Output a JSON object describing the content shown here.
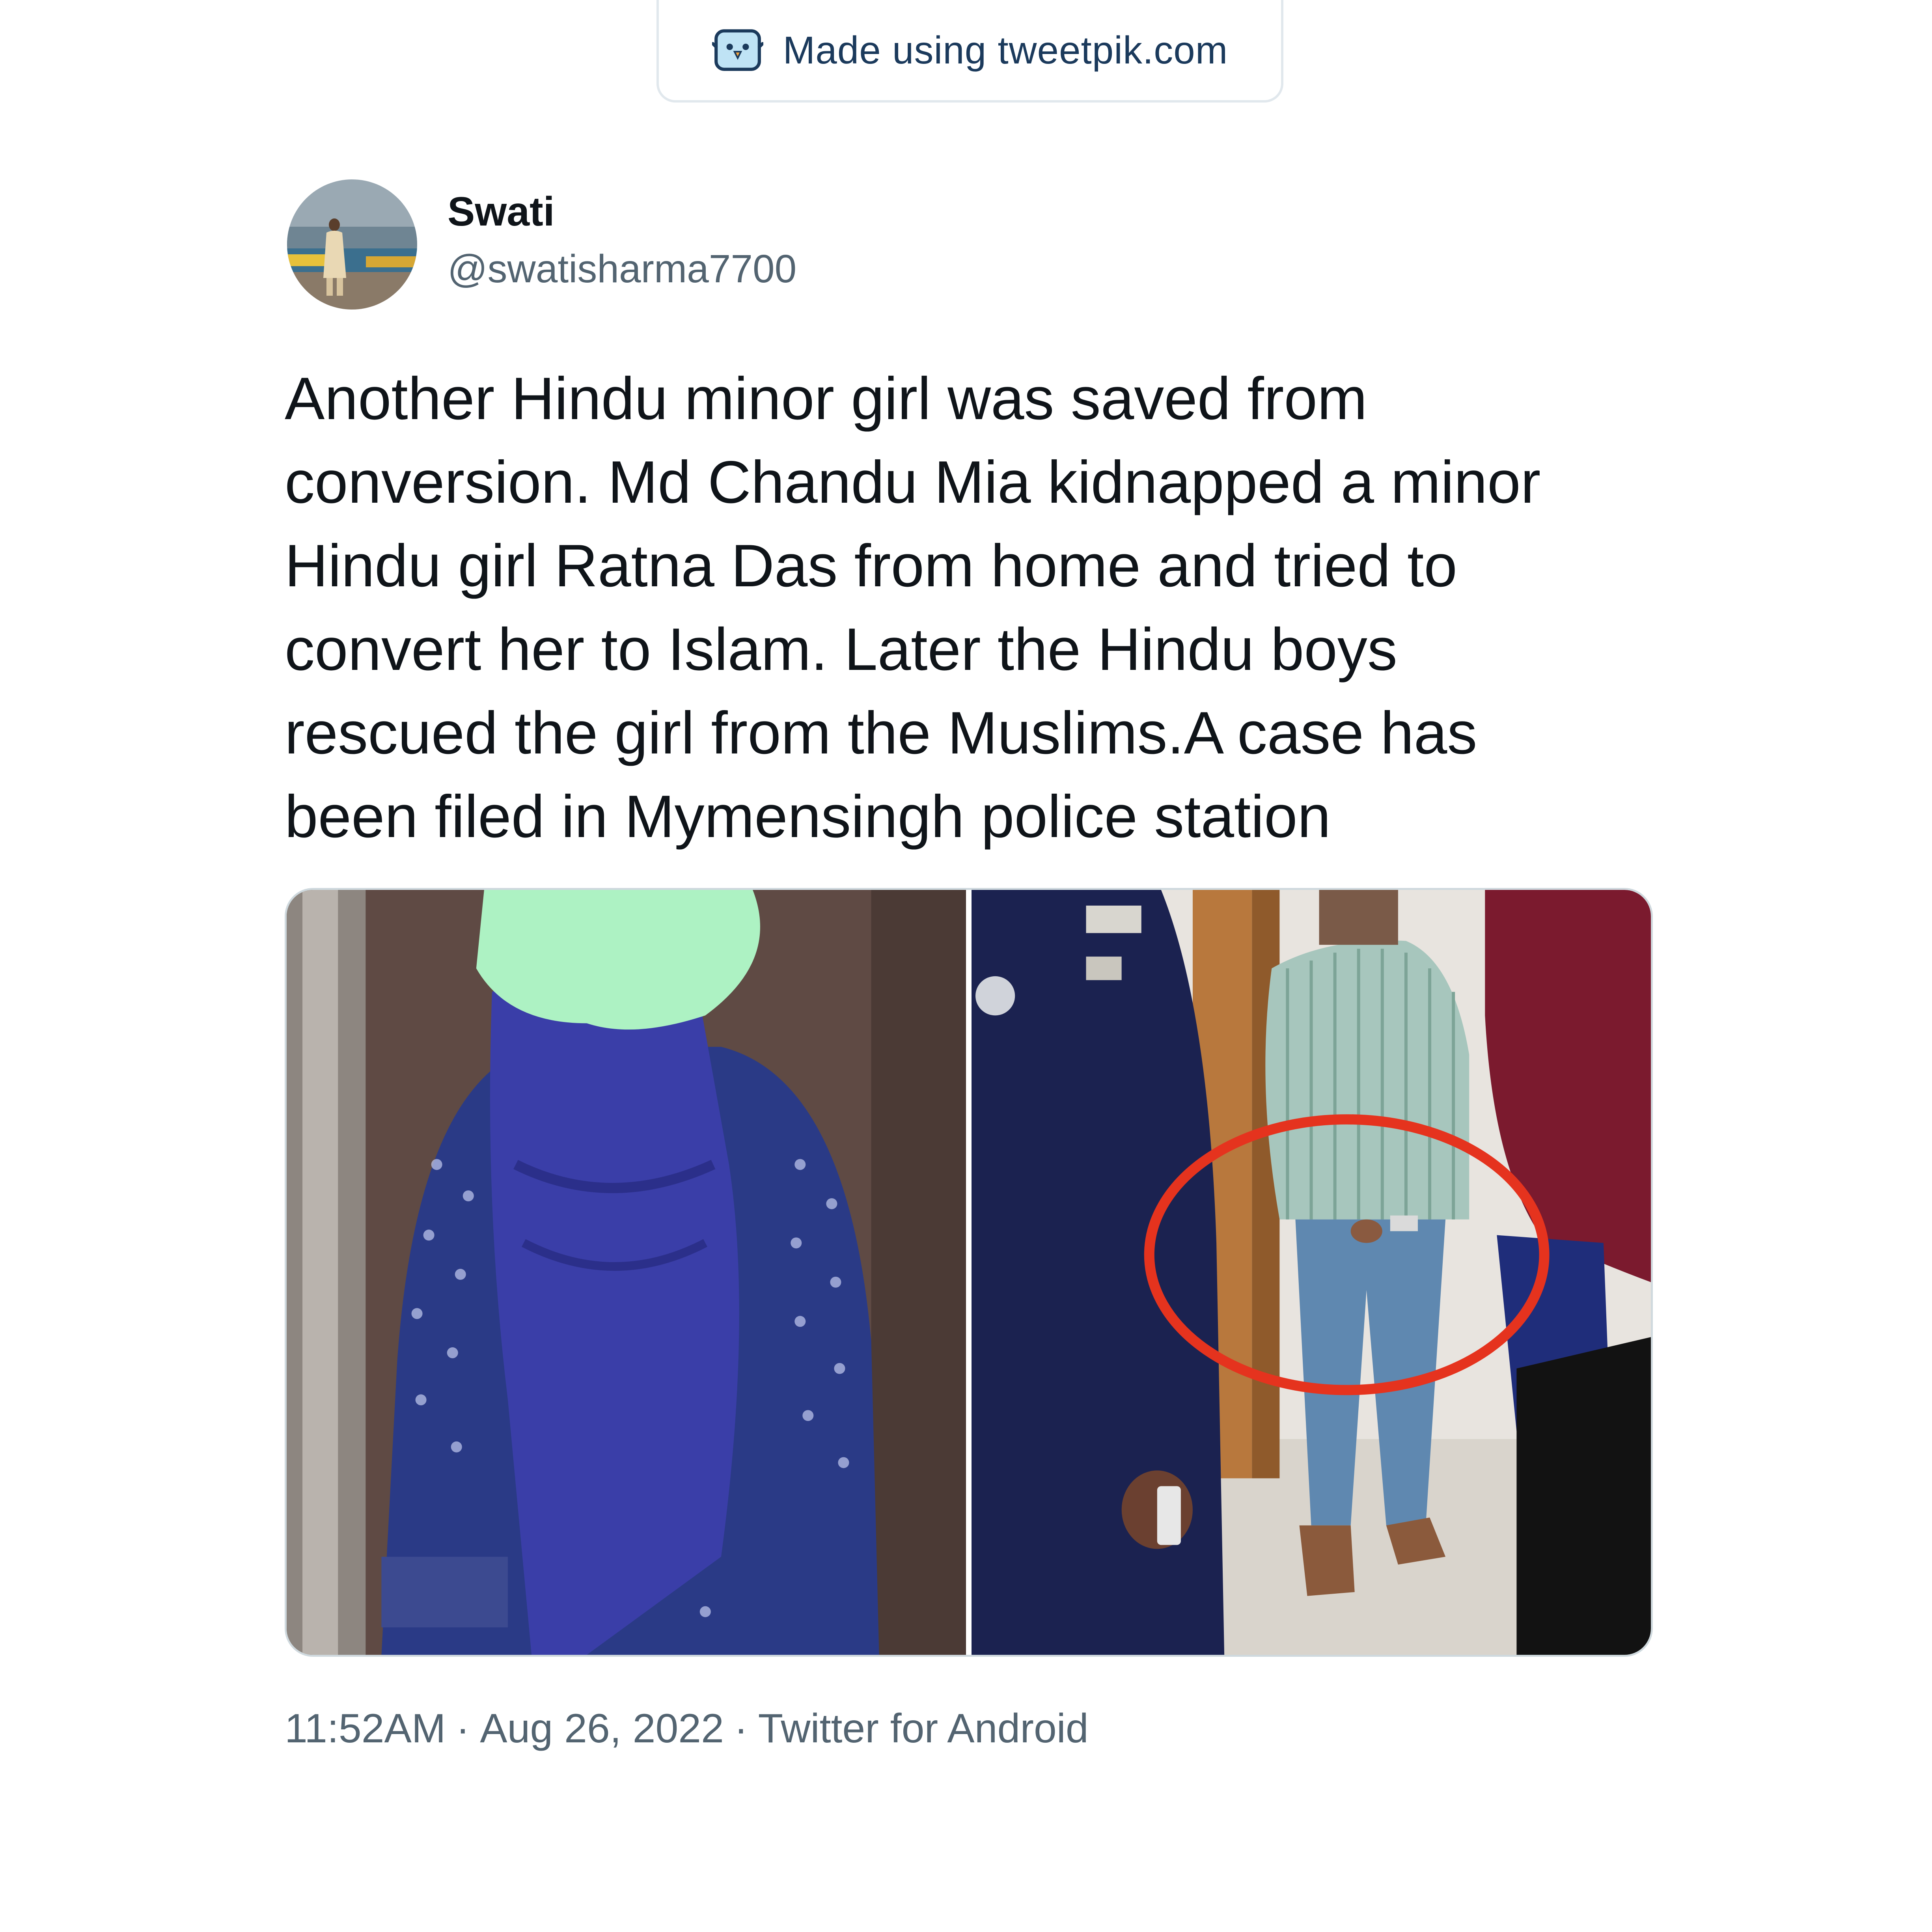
{
  "watermark": {
    "text": "Made using tweetpik.com",
    "icon": "tweetpik-bird-icon"
  },
  "author": {
    "display_name": "Swati",
    "handle": "@swatisharma7700",
    "avatar": "profile-photo"
  },
  "tweet": {
    "lines": [
      "Another Hindu minor girl was saved from",
      "conversion. Md Chandu Mia kidnapped a minor",
      "Hindu girl Ratna Das from home and tried to",
      "convert her to Islam. Later the Hindu boys",
      "rescued the girl from the Muslims.A case has",
      "been filed in Mymensingh police station"
    ]
  },
  "media": {
    "count": 2,
    "items": [
      "photo-girl-in-blue-scarf",
      "photo-man-with-police-circled"
    ]
  },
  "meta": {
    "time": "11:52AM",
    "date": "Aug 26, 2022",
    "source": "Twitter for Android",
    "separator": "·"
  },
  "colors": {
    "text_primary": "#0f1419",
    "text_secondary": "#536471",
    "border": "#cfd9de",
    "watermark_text": "#1b3a5c",
    "annotation_circle": "#e5331e"
  }
}
